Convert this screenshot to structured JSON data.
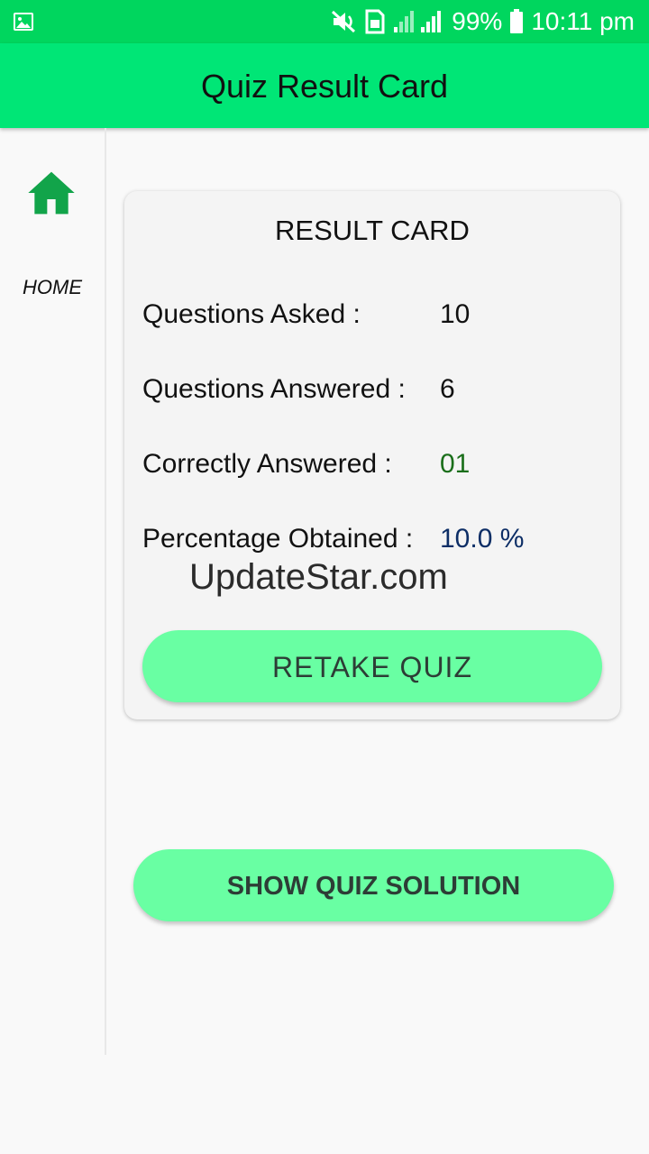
{
  "status_bar": {
    "battery": "99%",
    "time": "10:11 pm"
  },
  "app_bar": {
    "title": "Quiz Result Card"
  },
  "sidebar": {
    "home_label": "HOME"
  },
  "card": {
    "title": "RESULT CARD",
    "rows": [
      {
        "label": "Questions Asked :",
        "value": "10"
      },
      {
        "label": "Questions Answered :",
        "value": "6"
      },
      {
        "label": "Correctly Answered :",
        "value": "01"
      },
      {
        "label": "Percentage Obtained :",
        "value": "10.0 %"
      }
    ],
    "watermark": "UpdateStar.com",
    "retake_label": "RETAKE QUIZ"
  },
  "show_solution_label": "SHOW QUIZ SOLUTION",
  "colors": {
    "status_bar": "#00d65e",
    "app_bar": "#00e676",
    "button": "#69ffa3",
    "home_icon": "#12a44a",
    "correct_value": "#1a6e1a",
    "percentage_value": "#0d2e66"
  },
  "icons": [
    "gallery-icon",
    "mute-icon",
    "sim-icon",
    "signal-icon",
    "battery-icon",
    "home-icon"
  ]
}
